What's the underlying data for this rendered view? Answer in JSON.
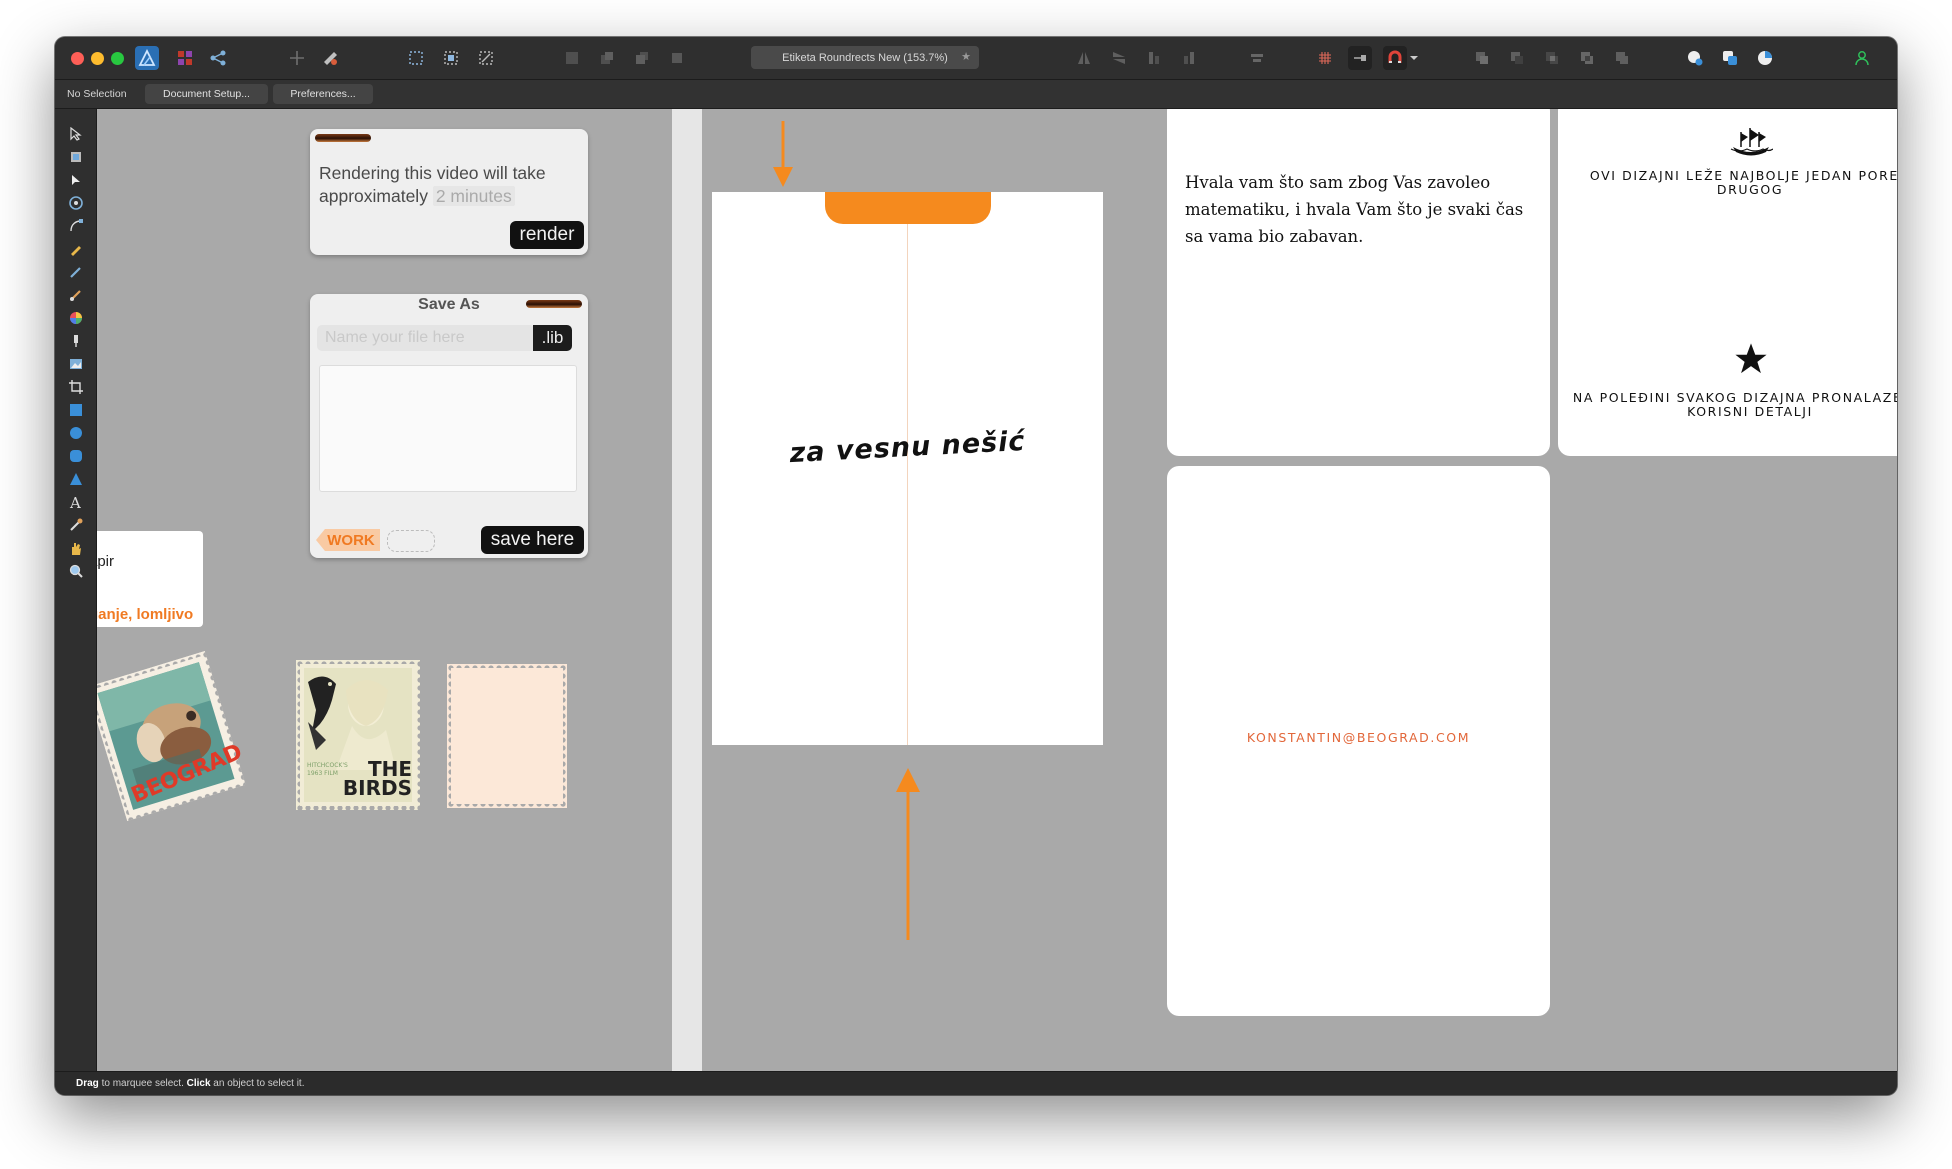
{
  "app": {
    "document_tab": "Etiketa Roundrects New (153.7%)",
    "document_tab_star": "★"
  },
  "toolbar_icons": [
    "affinity-logo-icon",
    "persona-pixel-icon",
    "persona-export-icon",
    "move-icon",
    "snapping-icon",
    "select-all-icon",
    "select-none-icon",
    "transform-icon",
    "order-icon",
    "align-icon",
    "document-tab",
    "flip-icon",
    "grid-icon",
    "snap-magnet-icon",
    "boolean-add-icon",
    "assistant-icon",
    "color-icon",
    "account-icon"
  ],
  "context_bar": {
    "selection_label": "No Selection",
    "document_setup": "Document Setup...",
    "preferences": "Preferences..."
  },
  "status_bar": {
    "drag": "Drag",
    "drag_text": " to marquee select. ",
    "click": "Click",
    "click_text": " an object to select it."
  },
  "render_panel": {
    "text": "Rendering this video will take approximately",
    "minutes": "2 minutes",
    "button": "render"
  },
  "save_panel": {
    "title": "Save As",
    "placeholder": "Name your file here",
    "extension": ".lib",
    "tag": "WORK",
    "button": "save here"
  },
  "partial_card": {
    "line1": "apir",
    "line2": "ganje, lomljivo"
  },
  "stamps": {
    "stamp1_text": "BEOGRAD",
    "stamp2_small": "HITCHCOCK'S\n1963   FILM",
    "stamp2_title_1": "THE",
    "stamp2_title_2": "BIRDS"
  },
  "pages": {
    "script_text": "za vesnu nešić",
    "thanks_text": "Hvala vam što sam zbog Vas zavoleo matematiku, i hvala Vam što je svaki čas sa vama bio zabavan.",
    "caps_top": "OVI DIZAJNI LEŽE NAJBOLJE JEDAN PORED DRUGOG",
    "caps_bottom": "NA POLEĐINI SVAKOG DIZAJNA PRONALAZE SE KORISNI DETALJI",
    "email": "KONSTANTIN@BEOGRAD.COM"
  },
  "colors": {
    "accent_orange": "#f58a1e",
    "email_orange": "#e2673a",
    "canvas": "#a9a9a9"
  }
}
